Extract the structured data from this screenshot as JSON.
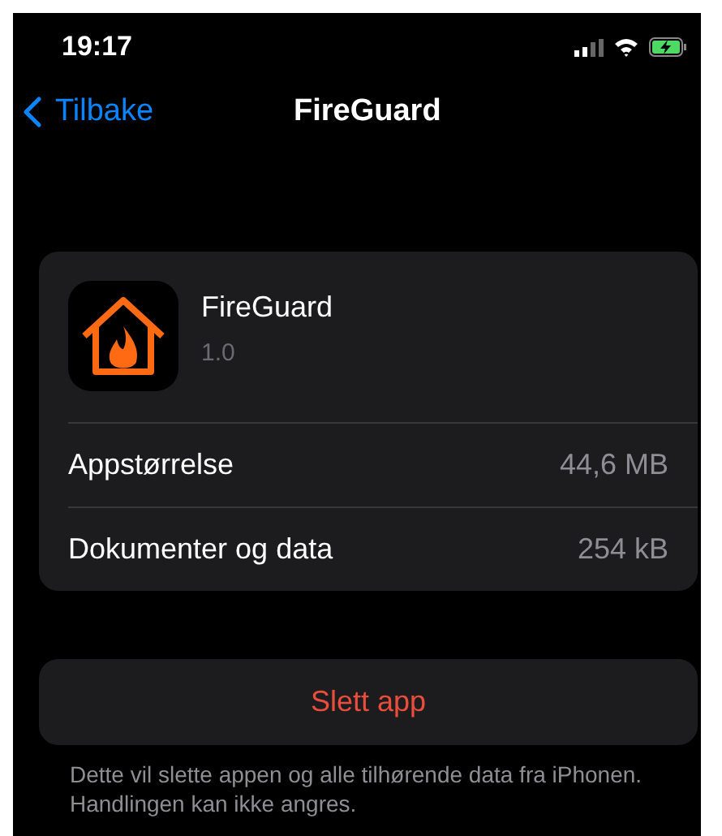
{
  "status_bar": {
    "time": "19:17",
    "battery_charging": true
  },
  "nav": {
    "back": "Tilbake",
    "title": "FireGuard"
  },
  "app": {
    "name": "FireGuard",
    "version": "1.0"
  },
  "rows": [
    {
      "label": "Appstørrelse",
      "value": "44,6 MB"
    },
    {
      "label": "Dokumenter og data",
      "value": "254 kB"
    }
  ],
  "delete_button": "Slett app",
  "footer": "Dette vil slette appen og alle tilhørende data fra iPhonen. Handlingen kan ikke angres."
}
